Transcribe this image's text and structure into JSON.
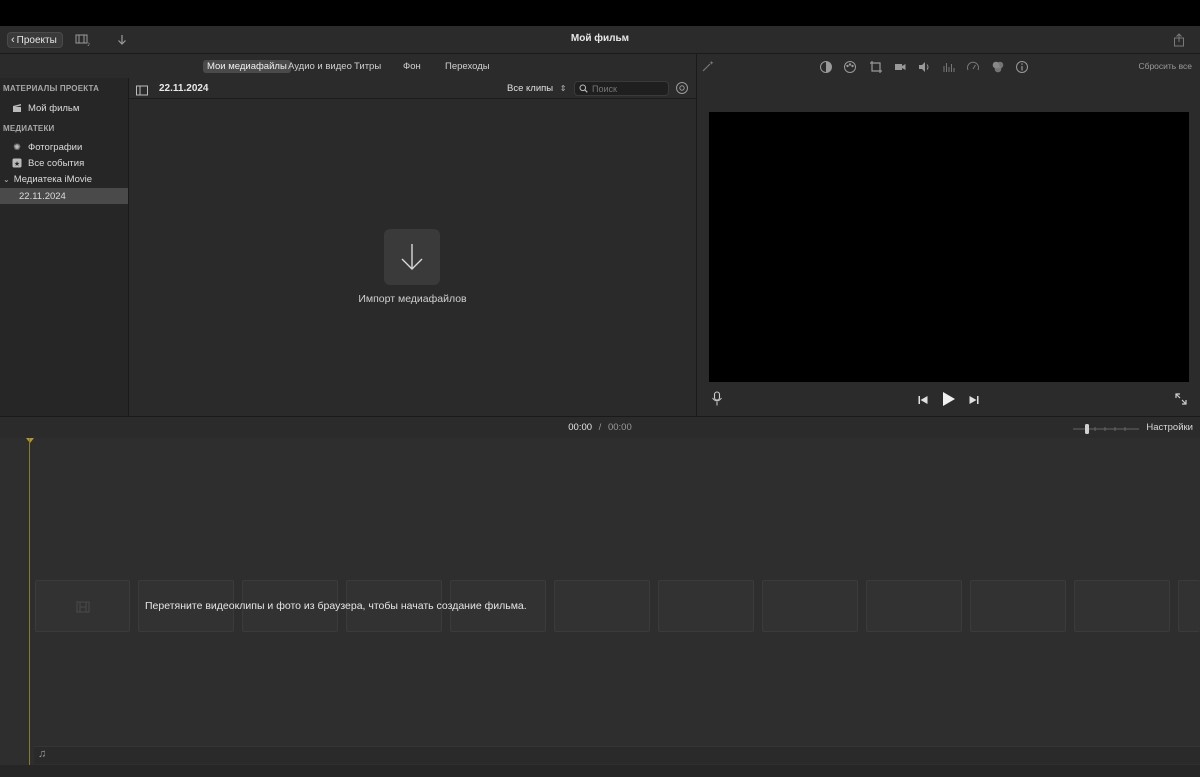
{
  "titlebar": {
    "back_label": "Проекты",
    "window_title": "Мой фильм",
    "icons": [
      "media-view-icon",
      "import-arrow-icon",
      "share-icon"
    ]
  },
  "tabs": [
    {
      "label": "Мои медиафайлы",
      "active": true
    },
    {
      "label": "Аудио и видео",
      "active": false
    },
    {
      "label": "Титры",
      "active": false
    },
    {
      "label": "Фон",
      "active": false
    },
    {
      "label": "Переходы",
      "active": false
    }
  ],
  "sidebar": {
    "project_header": "МАТЕРИАЛЫ ПРОЕКТА",
    "project_item": "Мой фильм",
    "libraries_header": "МЕДИАТЕКИ",
    "photos_item": "Фотографии",
    "all_events_item": "Все события",
    "library_item": "Медиатека iMovie",
    "event_item": "22.11.2024"
  },
  "browser": {
    "date": "22.11.2024",
    "clips_filter": "Все клипы",
    "search_placeholder": "Поиск",
    "import_label": "Импорт медиафайлов"
  },
  "viewer": {
    "reset_all": "Сбросить все",
    "icons": [
      "magic-wand-icon",
      "color-balance-icon",
      "color-correction-icon",
      "crop-icon",
      "stabilization-icon",
      "volume-icon",
      "equalizer-icon",
      "speed-icon",
      "clip-filter-icon",
      "info-icon"
    ]
  },
  "timeline": {
    "current_time": "00:00",
    "separator": "/",
    "total_time": "00:00",
    "settings_label": "Настройки",
    "drop_hint": "Перетяните видеоклипы и фото из браузера, чтобы начать создание фильма."
  },
  "colors": {
    "selected": "#4a4a4a",
    "playhead": "#b59a2a",
    "background": "#2b2b2b"
  }
}
